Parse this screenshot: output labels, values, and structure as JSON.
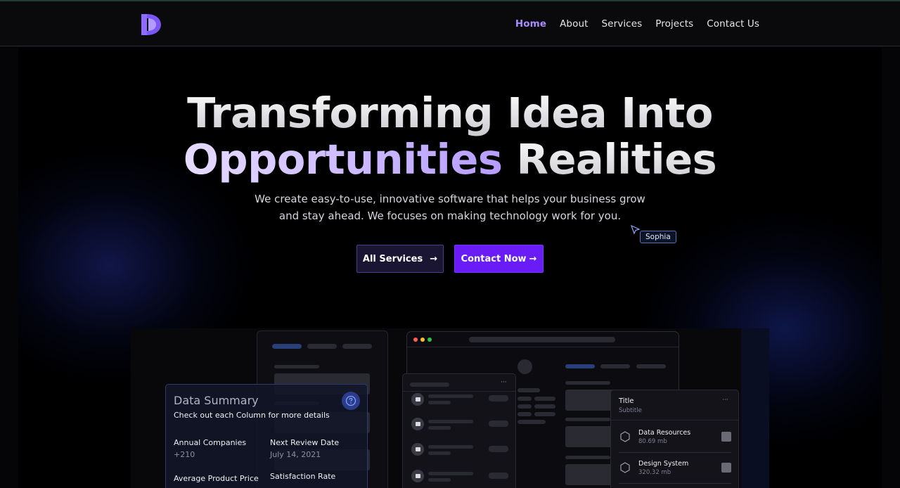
{
  "nav": {
    "logo_icon": "brand-d-play-icon",
    "items": [
      {
        "label": "Home",
        "active": true
      },
      {
        "label": "About",
        "active": false
      },
      {
        "label": "Services",
        "active": false
      },
      {
        "label": "Projects",
        "active": false
      },
      {
        "label": "Contact Us",
        "active": false
      }
    ]
  },
  "hero": {
    "title_line1": "Transforming Idea Into",
    "title_highlight": "Opportunities",
    "title_line2_rest": " Realities",
    "subtitle_line1": "We create easy-to-use, innovative software that helps your business grow",
    "subtitle_line2": "and stay ahead. We focuses on making technology work for you.",
    "cursor_tag": "Sophia",
    "btn_services": "All Services",
    "btn_contact": "Contact Now",
    "arrow": "→"
  },
  "mockup": {
    "data_summary": {
      "title": "Data Summary",
      "subtitle": "Check out each Column for more details",
      "annual_companies_label": "Annual Companies",
      "annual_companies_value": "+210",
      "next_review_label": "Next Review Date",
      "next_review_value": "July 14, 2021",
      "avg_price_label": "Average Product Price",
      "satisfaction_label": "Satisfaction Rate"
    },
    "list_menu": "···",
    "title_card": {
      "title": "Title",
      "subtitle": "Subtitle",
      "menu": "···",
      "rows": [
        {
          "name": "Data Resources",
          "size": "80.69 mb"
        },
        {
          "name": "Design System",
          "size": "320.32 mb"
        }
      ]
    }
  },
  "colors": {
    "accent_purple": "#6a1cf6",
    "active_nav": "#a98bff",
    "highlight_text": "#c9b6ff"
  }
}
